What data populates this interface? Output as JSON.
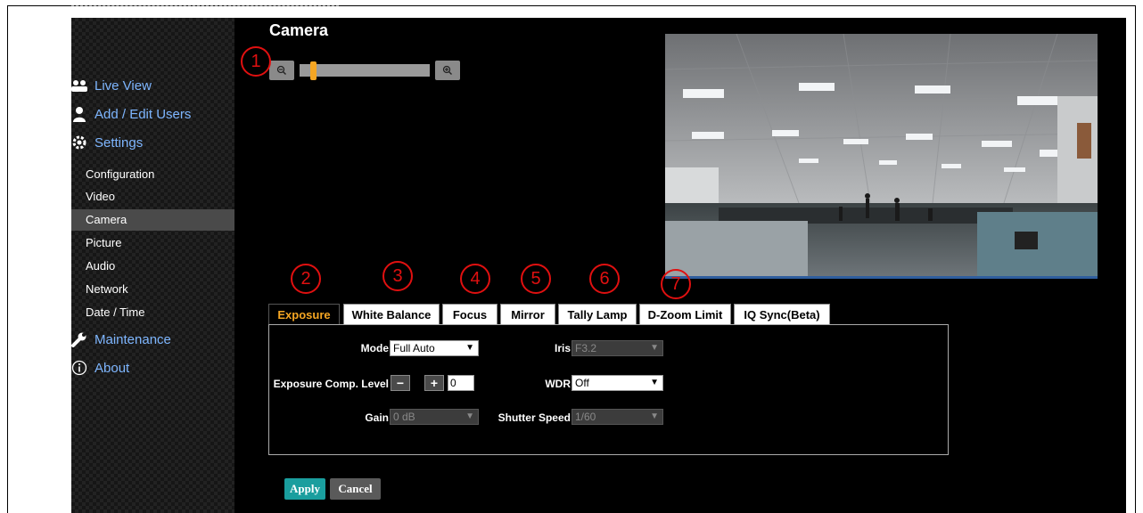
{
  "page_title": "Camera",
  "sidebar": {
    "main_items": [
      {
        "label": "Live View",
        "icon": "users-icon"
      },
      {
        "label": "Add / Edit Users",
        "icon": "user-icon"
      },
      {
        "label": "Settings",
        "icon": "gear-icon"
      },
      {
        "label": "Maintenance",
        "icon": "wrench-icon"
      },
      {
        "label": "About",
        "icon": "info-icon"
      }
    ],
    "sub_items": [
      "Configuration",
      "Video",
      "Camera",
      "Picture",
      "Audio",
      "Network",
      "Date / Time"
    ],
    "active_sub": "Camera"
  },
  "zoom": {
    "out_icon": "zoom-out-icon",
    "in_icon": "zoom-in-icon",
    "level": 0.1
  },
  "tabs": [
    "Exposure",
    "White Balance",
    "Focus",
    "Mirror",
    "Tally Lamp",
    "D-Zoom Limit",
    "IQ Sync(Beta)"
  ],
  "active_tab": "Exposure",
  "exposure": {
    "mode_label": "Mode",
    "mode_value": "Full Auto",
    "iris_label": "Iris",
    "iris_value": "F3.2",
    "comp_label": "Exposure Comp. Level",
    "comp_minus": "−",
    "comp_plus": "+",
    "comp_value": "0",
    "wdr_label": "WDR",
    "wdr_value": "Off",
    "gain_label": "Gain",
    "gain_value": "0 dB",
    "shutter_label": "Shutter Speed",
    "shutter_value": "1/60"
  },
  "buttons": {
    "apply": "Apply",
    "cancel": "Cancel"
  },
  "markers": [
    "1",
    "2",
    "3",
    "4",
    "5",
    "6",
    "7"
  ],
  "colors": {
    "accent": "#f5a623",
    "link": "#7eb6ff",
    "apply": "#1a9e9e",
    "marker": "#e01010"
  }
}
